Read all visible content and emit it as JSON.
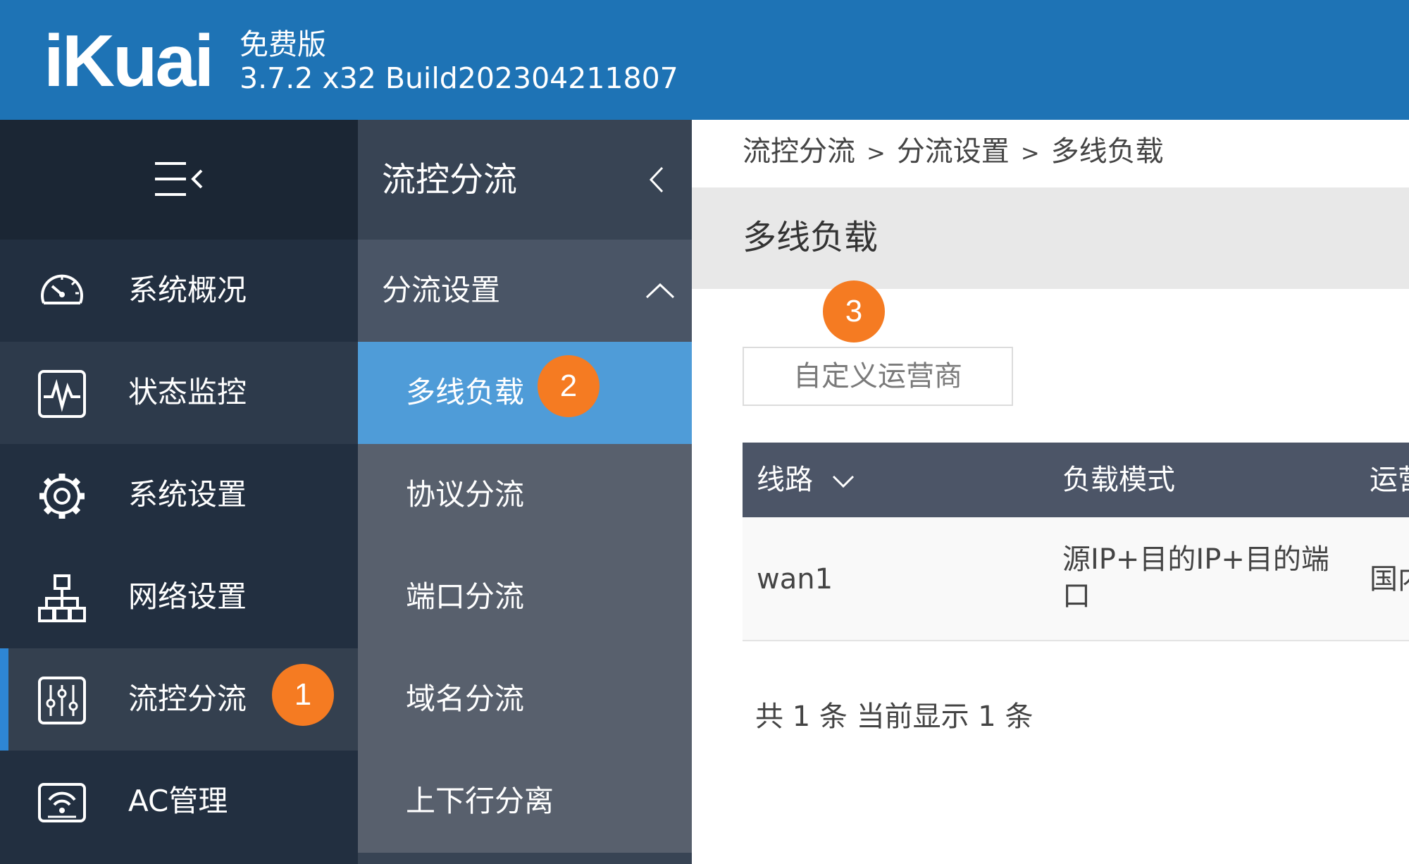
{
  "header": {
    "logo_text": "iKuai",
    "edition": "免费版",
    "version": "3.7.2 x32 Build202304211807"
  },
  "sidebar": {
    "toggle_icon": "menu-collapse-icon",
    "items": [
      {
        "label": "系统概况",
        "icon": "dashboard-gauge-icon"
      },
      {
        "label": "状态监控",
        "icon": "monitor-pulse-icon"
      },
      {
        "label": "系统设置",
        "icon": "gear-icon"
      },
      {
        "label": "网络设置",
        "icon": "network-topology-icon"
      },
      {
        "label": "流控分流",
        "icon": "sliders-icon",
        "active": true
      },
      {
        "label": "AC管理",
        "icon": "wifi-ap-icon"
      }
    ]
  },
  "subnav": {
    "title": "流控分流",
    "group_label": "分流设置",
    "items": [
      {
        "label": "多线负载",
        "active": true
      },
      {
        "label": "协议分流"
      },
      {
        "label": "端口分流"
      },
      {
        "label": "域名分流"
      },
      {
        "label": "上下行分离"
      }
    ]
  },
  "markers": [
    "1",
    "2",
    "3"
  ],
  "breadcrumb": {
    "items": [
      "流控分流",
      "分流设置",
      "多线负载"
    ],
    "separator": ">"
  },
  "page": {
    "title": "多线负载",
    "custom_isp_button": "自定义运营商"
  },
  "table": {
    "columns": [
      "线路",
      "负载模式",
      "运营"
    ],
    "rows": [
      {
        "line": "wan1",
        "mode": "源IP+目的IP+目的端口",
        "isp": "国内"
      }
    ]
  },
  "pagination": {
    "info": "共 1 条 当前显示 1 条"
  },
  "colors": {
    "header_bg": "#1e73b5",
    "sidebar_bg": "#222f40",
    "subnav_bg": "#58606d",
    "active_sub_item": "#4f9cd8",
    "marker": "#f57b22",
    "table_header": "#4c5567"
  }
}
